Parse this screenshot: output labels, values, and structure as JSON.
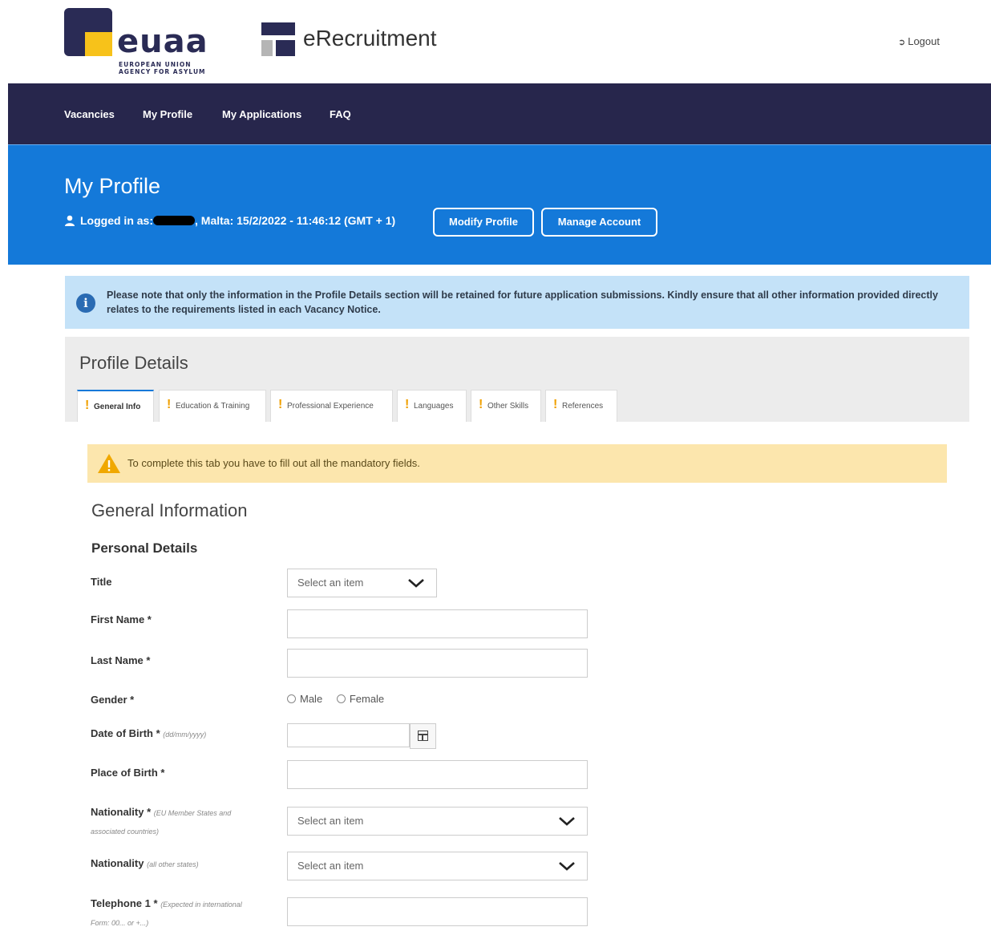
{
  "header": {
    "logo": {
      "brand": "euaa",
      "subline_1": "EUROPEAN UNION",
      "subline_2": "AGENCY FOR ASYLUM"
    },
    "app_name": "eRecruitment",
    "logout_label": "Logout"
  },
  "nav": {
    "items": [
      {
        "label": "Vacancies"
      },
      {
        "label": "My Profile"
      },
      {
        "label": "My Applications"
      },
      {
        "label": "FAQ"
      }
    ]
  },
  "banner": {
    "title": "My Profile",
    "logged_in_prefix": "Logged in as:",
    "logged_in_suffix": ", Malta: 15/2/2022 - 11:46:12 (GMT + 1)",
    "modify_profile_label": "Modify Profile",
    "manage_account_label": "Manage Account"
  },
  "info_alert": {
    "text": "Please note that only the information in the Profile Details section will be retained for future application submissions. Kindly ensure that all other information provided directly relates to the requirements listed in each Vacancy Notice."
  },
  "profile": {
    "title": "Profile Details",
    "tabs": [
      {
        "label": "General Info",
        "active": true
      },
      {
        "label": "Education & Training",
        "active": false
      },
      {
        "label": "Professional Experience",
        "active": false
      },
      {
        "label": "Languages",
        "active": false
      },
      {
        "label": "Other Skills",
        "active": false
      },
      {
        "label": "References",
        "active": false
      }
    ],
    "warning": "To complete this tab you have to fill out all the mandatory fields.",
    "section_title": "General Information",
    "subsection_title": "Personal Details",
    "fields": {
      "title": {
        "label": "Title",
        "value": "Select an item"
      },
      "first_name": {
        "label": "First Name *",
        "value": ""
      },
      "last_name": {
        "label": "Last Name *",
        "value": ""
      },
      "gender": {
        "label": "Gender *",
        "options": [
          "Male",
          "Female"
        ]
      },
      "dob": {
        "label": "Date of Birth *",
        "hint": "(dd/mm/yyyy)",
        "value": ""
      },
      "pob": {
        "label": "Place of Birth *",
        "value": ""
      },
      "nationality_eu": {
        "label": "Nationality *",
        "hint_1": "(EU Member States and",
        "hint_2": "associated countries)",
        "value": "Select an item"
      },
      "nationality_other": {
        "label": "Nationality",
        "hint": "(all other states)",
        "value": "Select an item"
      },
      "telephone1": {
        "label": "Telephone 1 *",
        "hint_1": "(Expected in international",
        "hint_2": "Form: 00... or +...)",
        "value": ""
      }
    }
  },
  "colors": {
    "nav_bg": "#27264c",
    "banner_bg": "#1479d9",
    "info_bg": "#c4e2f8",
    "warning_bg": "#fce6ad",
    "brand_yellow": "#f7c21a"
  },
  "icons": [
    "euaa-logo",
    "erecruitment-icon",
    "logout-icon",
    "user-icon",
    "info-icon",
    "exclamation-icon",
    "warning-icon",
    "chevron-down-icon",
    "calendar-icon"
  ]
}
